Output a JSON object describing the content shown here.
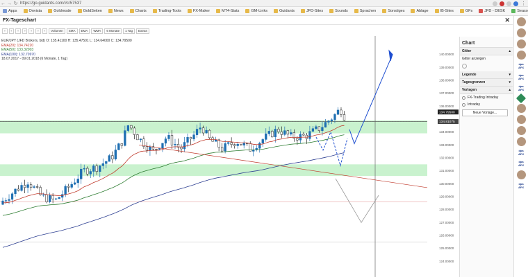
{
  "browser": {
    "url": "https://go.guidants.com/#c/57537",
    "bookmarks": [
      {
        "label": "Apps",
        "icon": "app"
      },
      {
        "label": "Onvista",
        "icon": "folder"
      },
      {
        "label": "Goldmode",
        "icon": "folder"
      },
      {
        "label": "GoldSeiten",
        "icon": "folder"
      },
      {
        "label": "News",
        "icon": "folder"
      },
      {
        "label": "Charts",
        "icon": "folder"
      },
      {
        "label": "Trading-Tools",
        "icon": "folder"
      },
      {
        "label": "FX-Maker",
        "icon": "folder"
      },
      {
        "label": "MT4-Stats",
        "icon": "folder"
      },
      {
        "label": "GM-Links",
        "icon": "folder"
      },
      {
        "label": "Guidants",
        "icon": "folder"
      },
      {
        "label": "JFD-Sites",
        "icon": "folder"
      },
      {
        "label": "Sounds",
        "icon": "folder"
      },
      {
        "label": "Sprachen",
        "icon": "folder"
      },
      {
        "label": "Sonstiges",
        "icon": "folder"
      },
      {
        "label": "Ablage",
        "icon": "folder"
      },
      {
        "label": "IB-Sites",
        "icon": "folder"
      },
      {
        "label": "GFs",
        "icon": "folder"
      },
      {
        "label": "JFD - DESK",
        "icon": "red"
      },
      {
        "label": "SeasonalBull",
        "icon": "grn"
      },
      {
        "label": "JFD - YouTube",
        "icon": "red"
      }
    ]
  },
  "window": {
    "title": "FX-Tageschart"
  },
  "toolbar": {
    "items": [
      "Volumen",
      "SMA",
      "EMA",
      "WMA",
      "6 Monate",
      "1 Tag",
      "Extras"
    ]
  },
  "legend": {
    "line1": "EUR/JPY (JFD Brokers, bid) O: 135.41100 H: 135.47501 L: 134.64000 C: 134.79500",
    "line2": "EMA(20): 134.74220",
    "line3": "EMA(50): 133.32003",
    "line4": "EMA(100): 132.70970",
    "line5": "18.07.2017 - 09.01.2018 (6 Monate, 1 Tag)"
  },
  "chart_data": {
    "type": "candlestick",
    "instrument": "EUR/JPY",
    "timeframe": "1 Tag",
    "range_label": "18.07.2017 - 09.01.2018",
    "ylim": [
      123.0,
      141.0
    ],
    "y_ticks": [
      "140.00000",
      "139.00000",
      "138.00000",
      "137.00000",
      "136.00000",
      "134.00000",
      "133.00000",
      "132.00000",
      "131.00000",
      "130.00000",
      "129.00000",
      "128.00000",
      "127.00000",
      "126.00000",
      "125.00000",
      "124.00000"
    ],
    "last_price_label": "134.79500",
    "cursor_price_label": "134.81075",
    "colors": {
      "up": "#1f6fb2",
      "down": "#222222",
      "ema20": "#c0392b",
      "ema50": "#2e7d32",
      "ema100": "#2c3e91",
      "zone": "#9de8a6",
      "projection": "#1f4fd0"
    }
  },
  "side_panel": {
    "title": "Chart",
    "sections": {
      "gitter": "Gitter",
      "gitter_anzeigen": "Gitter anzeigen",
      "legende": "Legende",
      "tagesgrenzen": "Tagesgrenzen",
      "vorlagen": "Vorlagen",
      "vorlage1": "FX-Trading Intraday",
      "vorlage2": "Intraday",
      "new_button": "Neue Vorlage..."
    }
  }
}
